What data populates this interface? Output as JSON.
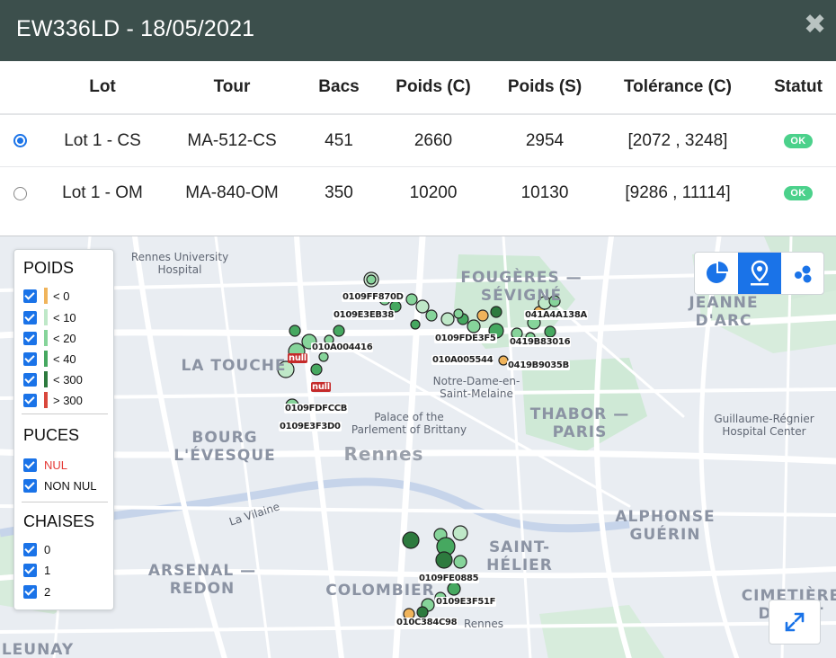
{
  "header": {
    "title": "EW336LD - 18/05/2021",
    "close_icon": "close-icon"
  },
  "table": {
    "columns": [
      "Lot",
      "Tour",
      "Bacs",
      "Poids (C)",
      "Poids (S)",
      "Tolérance (C)",
      "Statut"
    ],
    "rows": [
      {
        "selected": true,
        "lot": "Lot 1 - CS",
        "tour": "MA-512-CS",
        "bacs": "451",
        "poids_c": "2660",
        "poids_s": "2954",
        "tolerance": "[2072 , 3248]",
        "statut": "OK"
      },
      {
        "selected": false,
        "lot": "Lot 1 - OM",
        "tour": "MA-840-OM",
        "bacs": "350",
        "poids_c": "10200",
        "poids_s": "10130",
        "tolerance": "[9286 , 11114]",
        "statut": "OK"
      }
    ]
  },
  "legend": {
    "poids": {
      "title": "POIDS",
      "items": [
        {
          "label": "< 0",
          "color": "#f0b45b"
        },
        {
          "label": "< 10",
          "color": "#bfe8c8"
        },
        {
          "label": "< 20",
          "color": "#86d49a"
        },
        {
          "label": "< 40",
          "color": "#46a860"
        },
        {
          "label": "< 300",
          "color": "#2d7a3e"
        },
        {
          "label": "> 300",
          "color": "#d9473c"
        }
      ]
    },
    "puces": {
      "title": "PUCES",
      "items": [
        "NUL",
        "NON NUL"
      ],
      "nul_color": "#e53935"
    },
    "chaises": {
      "title": "CHAISES",
      "items": [
        "0",
        "1",
        "2"
      ]
    }
  },
  "view_buttons": [
    "pie-chart-icon",
    "map-marker-icon",
    "scatter-icon"
  ],
  "map": {
    "places": {
      "rennes_hospital": "Rennes University\nHospital",
      "fougeres": "FOUGÈRES —\nSÉVIGNÉ",
      "jeanne": "JEANNE\nD'ARC",
      "touche": "LA TOUCHE",
      "notre_dame": "Notre-Dame-en-\nSaint-Melaine",
      "thabor": "THABOR —\nPARIS",
      "guillaume": "Guillaume-Régnier\nHospital Center",
      "palace": "Palace of the\nParlement of Brittany",
      "bourg": "BOURG\nL'ÉVESQUE",
      "rennes": "Rennes",
      "vilaine": "La Vilaine",
      "alphonse": "ALPHONSE\nGUÉRIN",
      "saint_helier": "SAINT-\nHÉLIER",
      "arsenal": "ARSENAL —\nREDON",
      "colombier": "COLOMBIER",
      "cimetiere": "CIMETIÈRE\nDE EST",
      "leunay": "LEUNAY",
      "rennes_small": "Rennes"
    },
    "tags": [
      "0109FF870D",
      "0109E3EB38",
      "010A004416",
      "null",
      "null",
      "0109FDFCCB",
      "0109E3F3D0",
      "0109FDE3F5",
      "041A4A138A",
      "0419B83016",
      "010A005544",
      "0419B9035B",
      "0109FE0885",
      "0109E3F51F",
      "010C384C98"
    ]
  }
}
